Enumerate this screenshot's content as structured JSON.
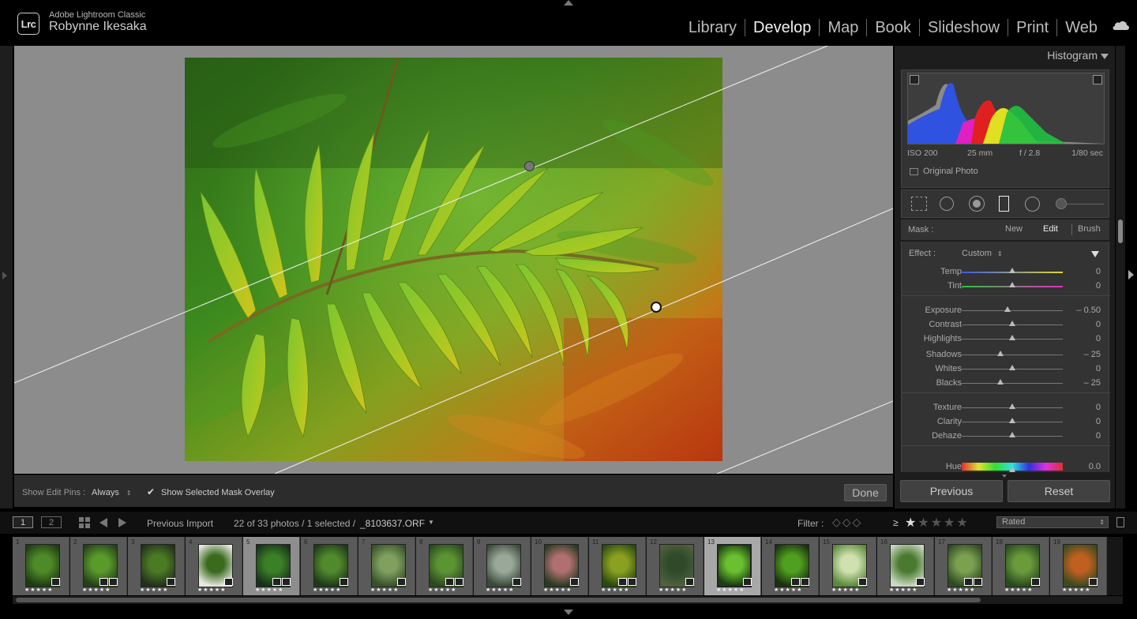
{
  "app": {
    "name": "Adobe Lightroom Classic",
    "logo_text": "Lrc",
    "user": "Robynne Ikesaka"
  },
  "modules": [
    {
      "label": "Library",
      "active": false
    },
    {
      "label": "Develop",
      "active": true
    },
    {
      "label": "Map",
      "active": false
    },
    {
      "label": "Book",
      "active": false
    },
    {
      "label": "Slideshow",
      "active": false
    },
    {
      "label": "Print",
      "active": false
    },
    {
      "label": "Web",
      "active": false
    }
  ],
  "icons": {
    "cloud": "cloud-icon",
    "panel_collapse": "triangle-icon"
  },
  "toolbar": {
    "edit_pins_label": "Show Edit Pins :",
    "edit_pins_value": "Always",
    "mask_overlay_label": "Show Selected Mask Overlay",
    "mask_overlay_checked": true,
    "done_label": "Done"
  },
  "histogram": {
    "title": "Histogram",
    "iso": "ISO 200",
    "focal": "25 mm",
    "aperture": "f / 2.8",
    "shutter": "1/80 sec",
    "original_photo_label": "Original Photo"
  },
  "mask": {
    "label": "Mask :",
    "new": "New",
    "edit": "Edit",
    "brush": "Brush"
  },
  "effect": {
    "label": "Effect :",
    "value": "Custom"
  },
  "sliders": [
    {
      "label": "Temp",
      "value": "0",
      "pos": 0.5,
      "track": "temp"
    },
    {
      "label": "Tint",
      "value": "0",
      "pos": 0.5,
      "track": "tint"
    },
    {
      "label": "Exposure",
      "value": "– 0.50",
      "pos": 0.45,
      "track": "plain"
    },
    {
      "label": "Contrast",
      "value": "0",
      "pos": 0.5,
      "track": "plain"
    },
    {
      "label": "Highlights",
      "value": "0",
      "pos": 0.5,
      "track": "plain"
    },
    {
      "label": "Shadows",
      "value": "– 25",
      "pos": 0.38,
      "track": "plain"
    },
    {
      "label": "Whites",
      "value": "0",
      "pos": 0.5,
      "track": "plain"
    },
    {
      "label": "Blacks",
      "value": "– 25",
      "pos": 0.38,
      "track": "plain"
    },
    {
      "label": "Texture",
      "value": "0",
      "pos": 0.5,
      "track": "plain"
    },
    {
      "label": "Clarity",
      "value": "0",
      "pos": 0.5,
      "track": "plain"
    },
    {
      "label": "Dehaze",
      "value": "0",
      "pos": 0.5,
      "track": "plain"
    },
    {
      "label": "Hue",
      "value": "0.0",
      "pos": 0.5,
      "track": "hue"
    }
  ],
  "buttons": {
    "previous": "Previous",
    "reset": "Reset"
  },
  "filmstrip": {
    "page1": "1",
    "page2": "2",
    "source": "Previous Import",
    "count": "22 of 33 photos / 1 selected /",
    "filename": "_8103637.ORF",
    "filter_label": "Filter :",
    "rating_op": "≥",
    "rated_value": "Rated",
    "stars": "★★★★★",
    "cells": [
      {
        "num": "1",
        "sel": false,
        "cur": false
      },
      {
        "num": "2",
        "sel": false,
        "cur": false
      },
      {
        "num": "3",
        "sel": false,
        "cur": false
      },
      {
        "num": "4",
        "sel": false,
        "cur": false
      },
      {
        "num": "5",
        "sel": true,
        "cur": false
      },
      {
        "num": "6",
        "sel": false,
        "cur": false
      },
      {
        "num": "7",
        "sel": false,
        "cur": false
      },
      {
        "num": "8",
        "sel": false,
        "cur": false
      },
      {
        "num": "9",
        "sel": false,
        "cur": false
      },
      {
        "num": "10",
        "sel": false,
        "cur": false
      },
      {
        "num": "11",
        "sel": false,
        "cur": false
      },
      {
        "num": "12",
        "sel": false,
        "cur": false
      },
      {
        "num": "13",
        "sel": false,
        "cur": true
      },
      {
        "num": "14",
        "sel": false,
        "cur": false
      },
      {
        "num": "15",
        "sel": false,
        "cur": false
      },
      {
        "num": "16",
        "sel": false,
        "cur": false
      },
      {
        "num": "17",
        "sel": false,
        "cur": false
      },
      {
        "num": "18",
        "sel": false,
        "cur": false
      },
      {
        "num": "19",
        "sel": false,
        "cur": false
      }
    ]
  },
  "colors": {
    "accent_active_module": "#f2f2f2",
    "panel_bg": "#333333",
    "stage_bg": "#8c8c8c"
  }
}
